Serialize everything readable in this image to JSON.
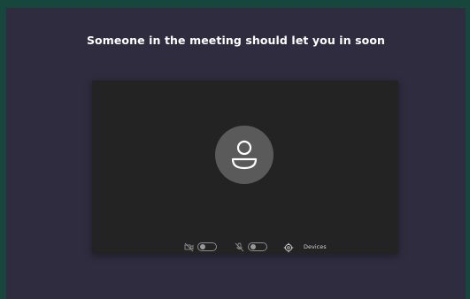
{
  "lobby": {
    "title": "Someone in the meeting should let you in soon"
  },
  "controls": {
    "camera": {
      "icon": "camera-off-icon",
      "state": "off"
    },
    "microphone": {
      "icon": "mic-off-icon",
      "state": "off"
    },
    "devices": {
      "icon": "gear-icon",
      "label": "Devices"
    }
  },
  "colors": {
    "background": "#16463c",
    "panel": "#2e2c3e",
    "preview": "#232323",
    "avatar": "#5a5a5a"
  }
}
